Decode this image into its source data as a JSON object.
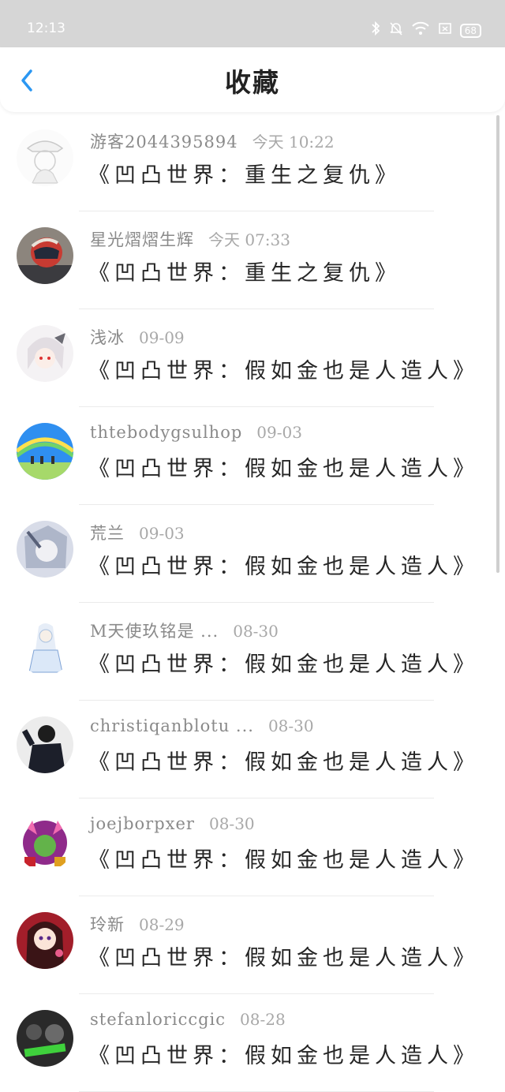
{
  "status_bar": {
    "time": "12:13",
    "battery": "68"
  },
  "header": {
    "title": "收藏"
  },
  "colors": {
    "accent": "#2b97f2",
    "status_bar_bg": "#d6d6d6"
  },
  "items": [
    {
      "name": "游客2044395894",
      "time": "今天 10:22",
      "title": "《凹凸世界：重生之复仇》"
    },
    {
      "name": "星光熠熠生辉",
      "time": "今天 07:33",
      "title": "《凹凸世界：重生之复仇》"
    },
    {
      "name": "浅冰",
      "time": "09-09",
      "title": "《凹凸世界：假如金也是人造人》"
    },
    {
      "name": "thtebodygsulhop",
      "time": "09-03",
      "title": "《凹凸世界：假如金也是人造人》"
    },
    {
      "name": "荒兰",
      "time": "09-03",
      "title": "《凹凸世界：假如金也是人造人》"
    },
    {
      "name": "M天使玖铭是 ...",
      "time": "08-30",
      "title": "《凹凸世界：假如金也是人造人》"
    },
    {
      "name": "christiqanblotu ...",
      "time": "08-30",
      "title": "《凹凸世界：假如金也是人造人》"
    },
    {
      "name": "joejborpxer",
      "time": "08-30",
      "title": "《凹凸世界：假如金也是人造人》"
    },
    {
      "name": "玲新",
      "time": "08-29",
      "title": "《凹凸世界：假如金也是人造人》"
    },
    {
      "name": "stefanloriccgic",
      "time": "08-28",
      "title": "《凹凸世界：假如金也是人造人》"
    }
  ]
}
